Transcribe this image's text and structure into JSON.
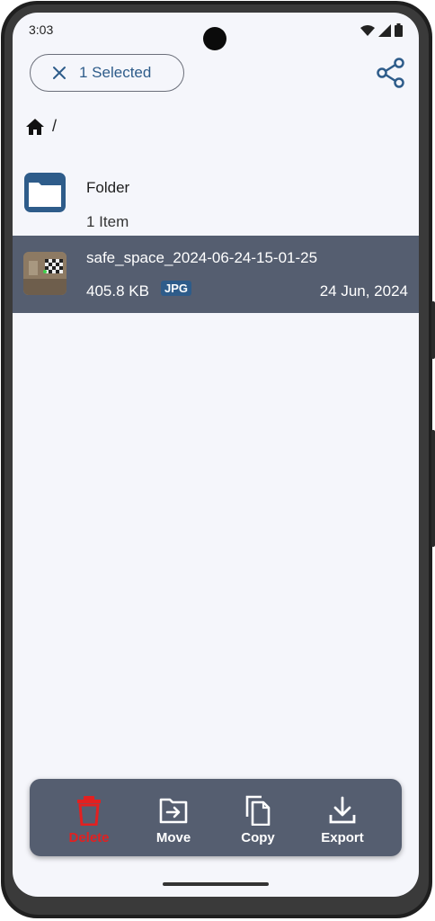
{
  "status_bar": {
    "time": "3:03"
  },
  "header": {
    "selection_label": "1 Selected",
    "close_icon": "close-icon",
    "share_icon": "share-icon"
  },
  "breadcrumb": {
    "home_icon": "home-icon",
    "separator": "/"
  },
  "items": [
    {
      "type": "folder",
      "name": "Folder",
      "subtitle": "1 Item",
      "selected": false
    },
    {
      "type": "file",
      "name": "safe_space_2024-06-24-15-01-25",
      "size": "405.8 KB",
      "badge": "JPG",
      "date": "24 Jun, 2024",
      "selected": true
    }
  ],
  "actions": {
    "delete": "Delete",
    "move": "Move",
    "copy": "Copy",
    "export": "Export"
  },
  "colors": {
    "accent": "#2e5c8a",
    "selected_row": "#555e70",
    "action_bar": "#555e70",
    "delete": "#e32020",
    "background": "#f5f6fb"
  }
}
